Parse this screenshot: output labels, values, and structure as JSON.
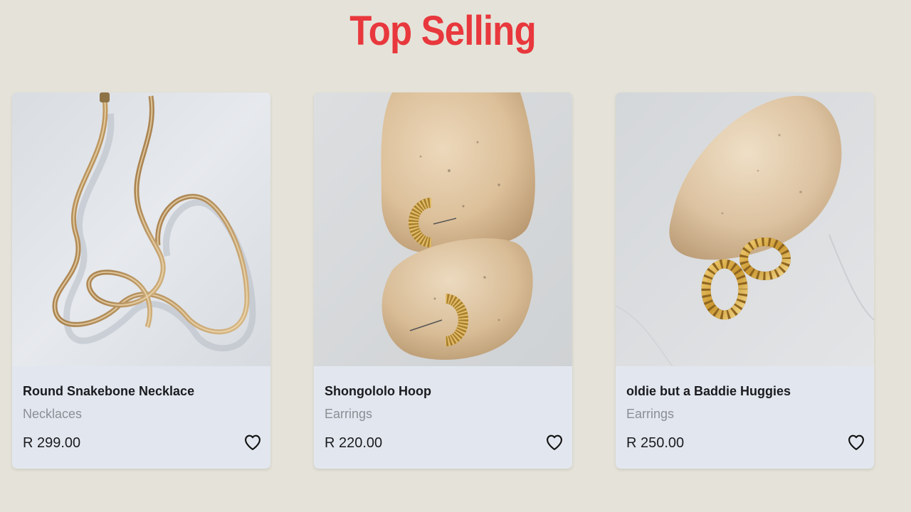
{
  "section": {
    "title": "Top Selling"
  },
  "colors": {
    "page_background": "#e5e3d9",
    "title": "#e8383d",
    "card_background": "#e2e7ef",
    "category_text": "#8b8e94"
  },
  "products": [
    {
      "name": "Round Snakebone Necklace",
      "category": "Necklaces",
      "price": "R 299.00",
      "image": "gold-snake-chain-necklace-photo",
      "icon": "heart-outline-icon"
    },
    {
      "name": "Shongololo Hoop",
      "category": "Earrings",
      "price": "R 220.00",
      "image": "gold-ribbed-hoop-earrings-on-stones-photo",
      "icon": "heart-outline-icon"
    },
    {
      "name": "oldie but a Baddie Huggies",
      "category": "Earrings",
      "price": "R 250.00",
      "image": "gold-croissant-huggie-earrings-on-stone-photo",
      "icon": "heart-outline-icon"
    }
  ]
}
